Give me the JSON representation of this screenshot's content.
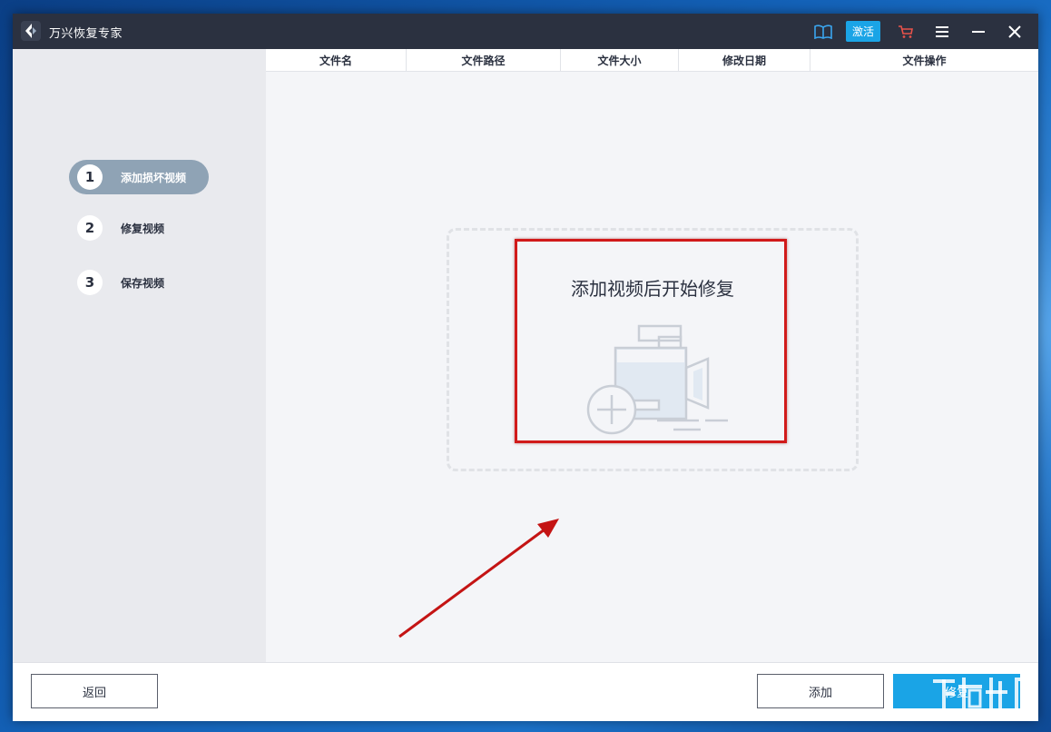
{
  "app": {
    "title": "万兴恢复专家",
    "activate_label": "激活"
  },
  "table": {
    "columns": [
      "文件名",
      "文件路径",
      "文件大小",
      "修改日期",
      "文件操作"
    ]
  },
  "steps": [
    {
      "number": "1",
      "label": "添加损坏视频",
      "active": true
    },
    {
      "number": "2",
      "label": "修复视频",
      "active": false
    },
    {
      "number": "3",
      "label": "保存视频",
      "active": false
    }
  ],
  "dropzone": {
    "prompt": "添加视频后开始修复"
  },
  "footer": {
    "back_label": "返回",
    "add_label": "添加",
    "repair_label": "修复"
  },
  "colors": {
    "titlebar": "#2b3140",
    "accent": "#1aa4e6",
    "annotation": "#d11a1a"
  },
  "icons": [
    "app-logo-icon",
    "book-icon",
    "cart-icon",
    "menu-icon",
    "minimize-icon",
    "close-icon",
    "add-video-icon"
  ]
}
